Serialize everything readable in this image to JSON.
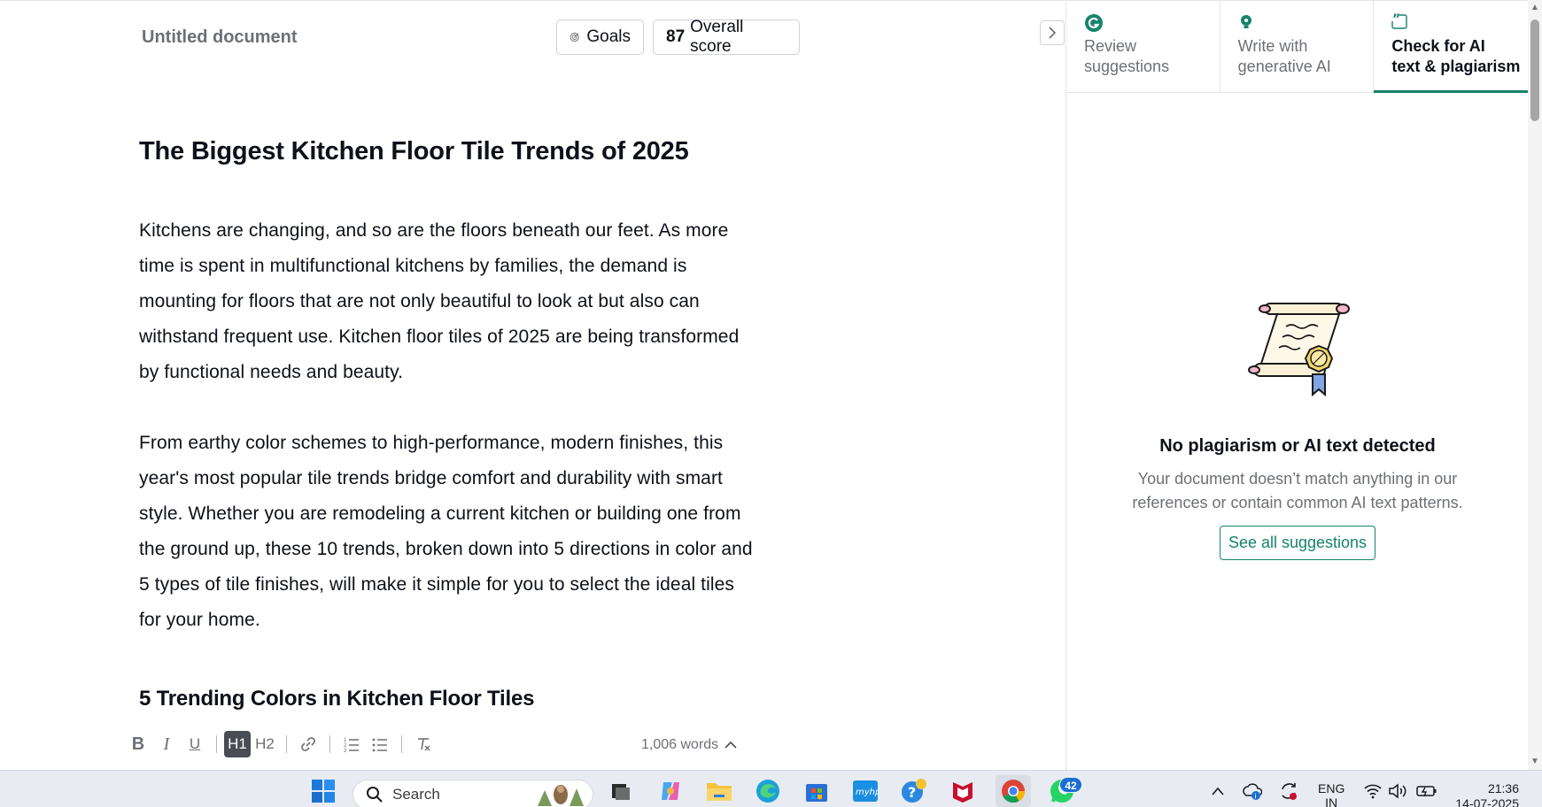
{
  "editor": {
    "doc_title": "Untitled document",
    "goals_label": "Goals",
    "score_value": "87",
    "score_label": "Overall score",
    "heading": "The Biggest Kitchen Floor Tile Trends of 2025",
    "paragraph1_lines": [
      "Kitchens are changing, and so are the floors beneath our feet. As more",
      "time is spent in multifunctional kitchens by families, the demand is",
      "mounting for floors that are not only beautiful to look at but also can",
      "withstand frequent use. Kitchen floor tiles of 2025 are being transformed",
      "by functional needs and beauty."
    ],
    "paragraph2_lines": [
      "From earthy color schemes to high-performance, modern finishes, this",
      "year's most popular tile trends bridge comfort and durability with smart",
      "style. Whether you are remodeling a current kitchen or building one from",
      "the ground up, these 10 trends, broken down into 5 directions in color and",
      "5 types of tile finishes, will make it simple for you to select the ideal tiles",
      "for your home."
    ],
    "subheading": "5 Trending Colors in Kitchen Floor Tiles"
  },
  "toolbar": {
    "bold": "B",
    "italic": "I",
    "underline": "U",
    "h1": "H1",
    "h2": "H2",
    "word_count": "1,006 words"
  },
  "panel": {
    "tabs": [
      {
        "label_line1": "Review",
        "label_line2": "suggestions",
        "icon": "grammarly-icon",
        "active": false
      },
      {
        "label_line1": "Write with",
        "label_line2": "generative AI",
        "icon": "lightbulb-icon",
        "active": false
      },
      {
        "label_line1": "Check for AI",
        "label_line2": "text & plagiarism",
        "icon": "quote-icon",
        "active": true
      }
    ],
    "empty_title": "No plagiarism or AI text detected",
    "empty_line1": "Your document doesn’t match anything in our",
    "empty_line2": "references or contain common AI text patterns.",
    "button_label": "See all suggestions"
  },
  "taskbar": {
    "search_label": "Search",
    "badge_count": "42",
    "lang_line1": "ENG",
    "lang_line2": "IN",
    "time": "21:36",
    "date": "14-07-2025"
  },
  "colors": {
    "accent": "#15846c",
    "text": "#0e101a",
    "muted": "#6d6f78"
  }
}
